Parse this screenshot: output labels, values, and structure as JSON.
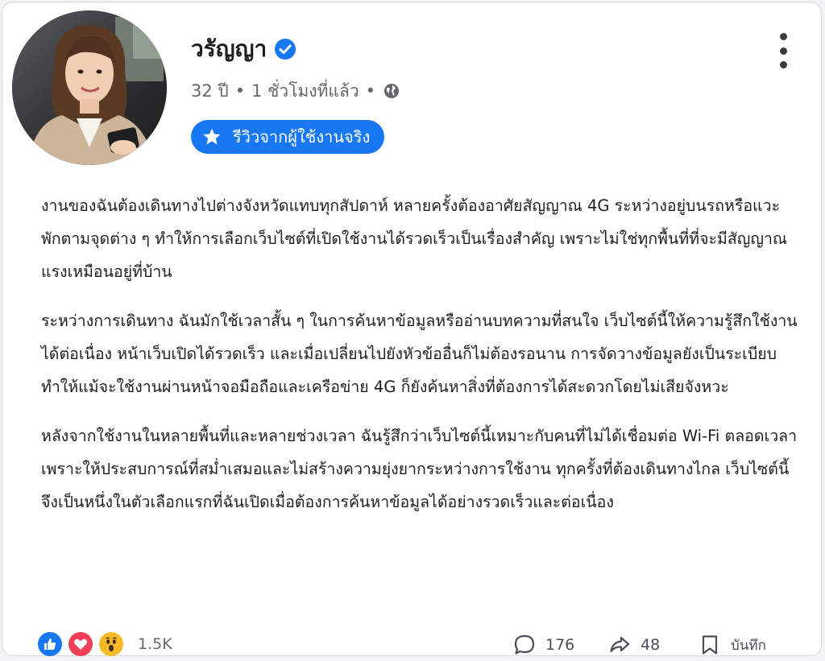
{
  "post": {
    "author_name": "วรัญญา",
    "age": "32 ปี",
    "time": "1 ชั่วโมงที่แล้ว",
    "separator": "•",
    "badge_label": "รีวิวจากผู้ใช้งานจริง",
    "paragraphs": [
      "งานของฉันต้องเดินทางไปต่างจังหวัดแทบทุกสัปดาห์ หลายครั้งต้องอาศัยสัญญาณ 4G ระหว่างอยู่บนรถหรือแวะพักตามจุดต่าง ๆ ทำให้การเลือกเว็บไซต์ที่เปิดใช้งานได้รวดเร็วเป็นเรื่องสำคัญ เพราะไม่ใช่ทุกพื้นที่ที่จะมีสัญญาณแรงเหมือนอยู่ที่บ้าน",
      "ระหว่างการเดินทาง ฉันมักใช้เวลาสั้น ๆ ในการค้นหาข้อมูลหรืออ่านบทความที่สนใจ เว็บไซต์นี้ให้ความรู้สึกใช้งานได้ต่อเนื่อง หน้าเว็บเปิดได้รวดเร็ว และเมื่อเปลี่ยนไปยังหัวข้ออื่นก็ไม่ต้องรอนาน การจัดวางข้อมูลยังเป็นระเบียบ ทำให้แม้จะใช้งานผ่านหน้าจอมือถือและเครือข่าย 4G ก็ยังค้นหาสิ่งที่ต้องการได้สะดวกโดยไม่เสียจังหวะ",
      "หลังจากใช้งานในหลายพื้นที่และหลายช่วงเวลา ฉันรู้สึกว่าเว็บไซต์นี้เหมาะกับคนที่ไม่ได้เชื่อมต่อ Wi-Fi ตลอดเวลา เพราะให้ประสบการณ์ที่สม่ำเสมอและไม่สร้างความยุ่งยากระหว่างการใช้งาน ทุกครั้งที่ต้องเดินทางไกล เว็บไซต์นี้จึงเป็นหนึ่งในตัวเลือกแรกที่ฉันเปิดเมื่อต้องการค้นหาข้อมูลได้อย่างรวดเร็วและต่อเนื่อง"
    ]
  },
  "footer": {
    "reaction_icons": [
      "thumbs-up-icon",
      "heart-icon",
      "wow-face-icon"
    ],
    "reaction_count": "1.5K",
    "comments_count": "176",
    "shares_count": "48",
    "save_label": "บันทึก"
  },
  "colors": {
    "accent": "#1877f2",
    "love": "#f33e58",
    "wow": "#f7b928",
    "text": "#1c1e21",
    "muted": "#65676b"
  }
}
